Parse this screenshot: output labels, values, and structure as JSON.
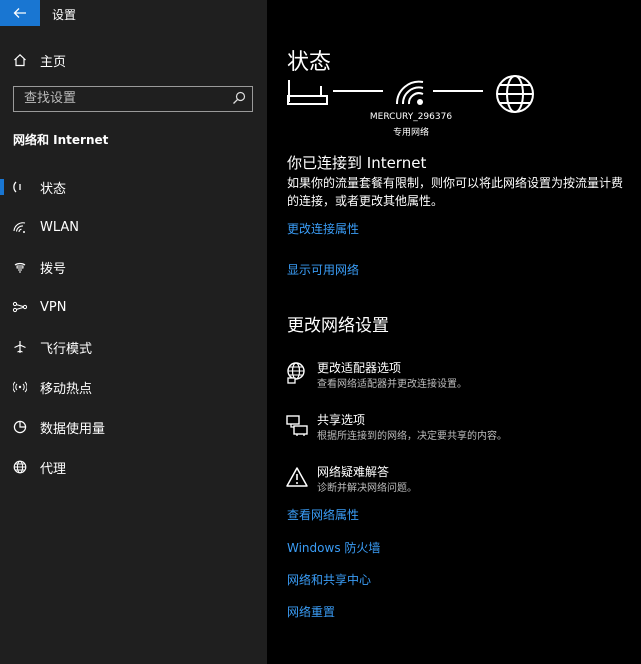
{
  "window": {
    "title": "设置"
  },
  "sidebar": {
    "home": "主页",
    "search_placeholder": "查找设置",
    "section": "网络和 Internet",
    "items": [
      {
        "label": "状态",
        "icon": "status-icon",
        "selected": true
      },
      {
        "label": "WLAN",
        "icon": "wifi-icon",
        "selected": false
      },
      {
        "label": "拨号",
        "icon": "dialup-icon",
        "selected": false
      },
      {
        "label": "VPN",
        "icon": "vpn-icon",
        "selected": false
      },
      {
        "label": "飞行模式",
        "icon": "airplane-icon",
        "selected": false
      },
      {
        "label": "移动热点",
        "icon": "hotspot-icon",
        "selected": false
      },
      {
        "label": "数据使用量",
        "icon": "data-usage-icon",
        "selected": false
      },
      {
        "label": "代理",
        "icon": "globe-icon",
        "selected": false
      }
    ]
  },
  "main": {
    "title": "状态",
    "network": {
      "name": "MERCURY_296376",
      "type": "专用网络"
    },
    "connected": {
      "heading": "你已连接到 Internet",
      "description": "如果你的流量套餐有限制，则你可以将此网络设置为按流量计费的连接，或者更改其他属性。"
    },
    "links_top": [
      "更改连接属性",
      "显示可用网络"
    ],
    "change_heading": "更改网络设置",
    "options": [
      {
        "title": "更改适配器选项",
        "desc": "查看网络适配器并更改连接设置。",
        "icon": "adapter-globe-icon"
      },
      {
        "title": "共享选项",
        "desc": "根据所连接到的网络，决定要共享的内容。",
        "icon": "sharing-icon"
      },
      {
        "title": "网络疑难解答",
        "desc": "诊断并解决网络问题。",
        "icon": "warning-icon"
      }
    ],
    "links_bottom": [
      "查看网络属性",
      "Windows 防火墙",
      "网络和共享中心",
      "网络重置"
    ]
  },
  "colors": {
    "accent": "#1976d2",
    "link": "#3a9cf5",
    "sidebar_bg": "#1f1f1f",
    "main_bg": "#000000"
  }
}
